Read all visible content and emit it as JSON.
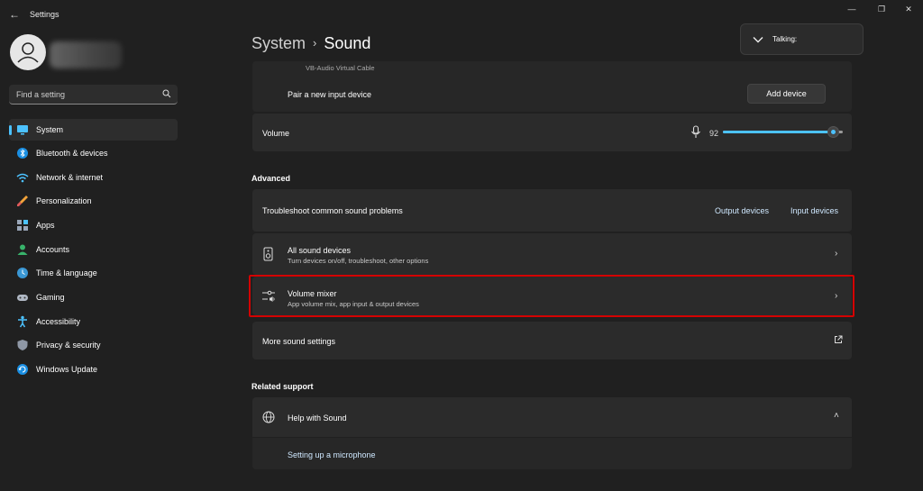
{
  "window": {
    "title": "Settings",
    "controls": [
      "—",
      "❐",
      "✕"
    ]
  },
  "search": {
    "placeholder": "Find a setting"
  },
  "sidebar": {
    "items": [
      {
        "label": "System",
        "icon": "monitor-icon",
        "active": true
      },
      {
        "label": "Bluetooth & devices",
        "icon": "bluetooth-icon"
      },
      {
        "label": "Network & internet",
        "icon": "wifi-icon"
      },
      {
        "label": "Personalization",
        "icon": "brush-icon"
      },
      {
        "label": "Apps",
        "icon": "apps-icon"
      },
      {
        "label": "Accounts",
        "icon": "person-icon"
      },
      {
        "label": "Time & language",
        "icon": "globe-clock-icon"
      },
      {
        "label": "Gaming",
        "icon": "gamepad-icon"
      },
      {
        "label": "Accessibility",
        "icon": "accessibility-icon"
      },
      {
        "label": "Privacy & security",
        "icon": "shield-icon"
      },
      {
        "label": "Windows Update",
        "icon": "update-icon"
      }
    ]
  },
  "breadcrumb": {
    "parent": "System",
    "separator": "›",
    "current": "Sound"
  },
  "input": {
    "cut_off_device": "VB-Audio Virtual Cable",
    "pair_label": "Pair a new input device",
    "add_button": "Add device",
    "volume_label": "Volume",
    "volume_value": "92",
    "volume_level": 92
  },
  "advanced": {
    "heading": "Advanced",
    "troubleshoot_label": "Troubleshoot common sound problems",
    "output_link": "Output devices",
    "input_link": "Input devices",
    "all_devices_title": "All sound devices",
    "all_devices_desc": "Turn devices on/off, troubleshoot, other options",
    "mixer_title": "Volume mixer",
    "mixer_desc": "App volume mix, app input & output devices",
    "more_settings": "More sound settings"
  },
  "related": {
    "heading": "Related support",
    "help_title": "Help with Sound",
    "help_link": "Setting up a microphone"
  },
  "talking": {
    "label": "Talking:"
  },
  "colors": {
    "accent": "#4cc2ff",
    "highlight": "#d40000",
    "background": "#202020",
    "card": "#2b2b2b"
  }
}
